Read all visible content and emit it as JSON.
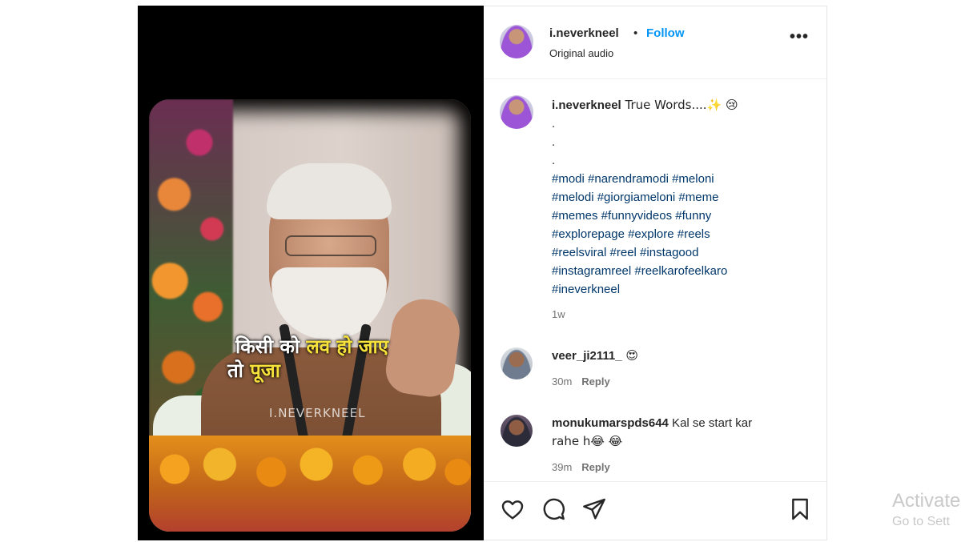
{
  "video": {
    "caption_line1_white": "किसी को ",
    "caption_line1_yellow": "लव हो जाए",
    "caption_line2_white": "तो ",
    "caption_line2_yellow": "पूजा",
    "watermark": "I.NEVERKNEEL"
  },
  "header": {
    "username": "i.neverkneel",
    "separator": "•",
    "follow_label": "Follow",
    "audio_label": "Original audio",
    "more_icon": "more-horizontal-icon"
  },
  "post_caption": {
    "username": "i.neverkneel",
    "text": " True Words....✨ 😢",
    "dots": [
      ".",
      ".",
      "."
    ],
    "hashtag_lines": [
      "#modi #narendramodi #meloni",
      "#melodi #giorgiameloni #meme",
      "#memes #funnyvideos #funny",
      "#explorepage #explore #reels",
      "#reelsviral #reel #instagood",
      "#instagramreel #reelkarofeelkaro",
      "#ineverkneel"
    ],
    "time": "1w"
  },
  "comments": [
    {
      "username": "veer_ji2111_",
      "text": "  😍",
      "time": "30m",
      "reply_label": "Reply"
    },
    {
      "username": "monukumarspds644",
      "text": " Kal se start kar",
      "text_line2": "rahe h😂 😂",
      "time": "39m",
      "reply_label": "Reply"
    }
  ],
  "actions": {
    "like_icon": "heart-icon",
    "comment_icon": "comment-icon",
    "share_icon": "send-icon",
    "save_icon": "bookmark-icon"
  },
  "activate_windows": {
    "title": "Activate",
    "subtitle": "Go to Sett"
  }
}
